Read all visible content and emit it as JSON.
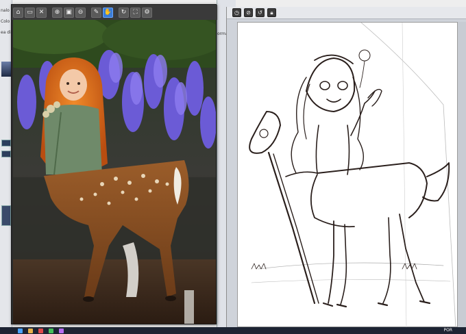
{
  "left_panel": {
    "texts": [
      "nalo",
      "Colo",
      "ea di"
    ]
  },
  "mid_panel": {
    "texts": [
      "orma"
    ]
  },
  "photo_viewer": {
    "toolbar_icons": [
      "home-icon",
      "folder-icon",
      "close-icon",
      "zoom-in-icon",
      "fit-window-icon",
      "zoom-out-icon",
      "pen-icon",
      "hand-icon",
      "rotate-icon",
      "fullscreen-icon",
      "settings-icon"
    ],
    "active_tool": "hand-icon"
  },
  "draw_app": {
    "toolbar_icons": [
      "clock-icon",
      "cancel-icon",
      "circle-arrow-icon",
      "lock-icon"
    ]
  },
  "taskbar": {
    "tray_lang": "POR"
  },
  "colors": {
    "hand_tool_active": "#3b7dd8",
    "sketch_line": "#2a1f1c",
    "taskbar": "#1d2433"
  }
}
